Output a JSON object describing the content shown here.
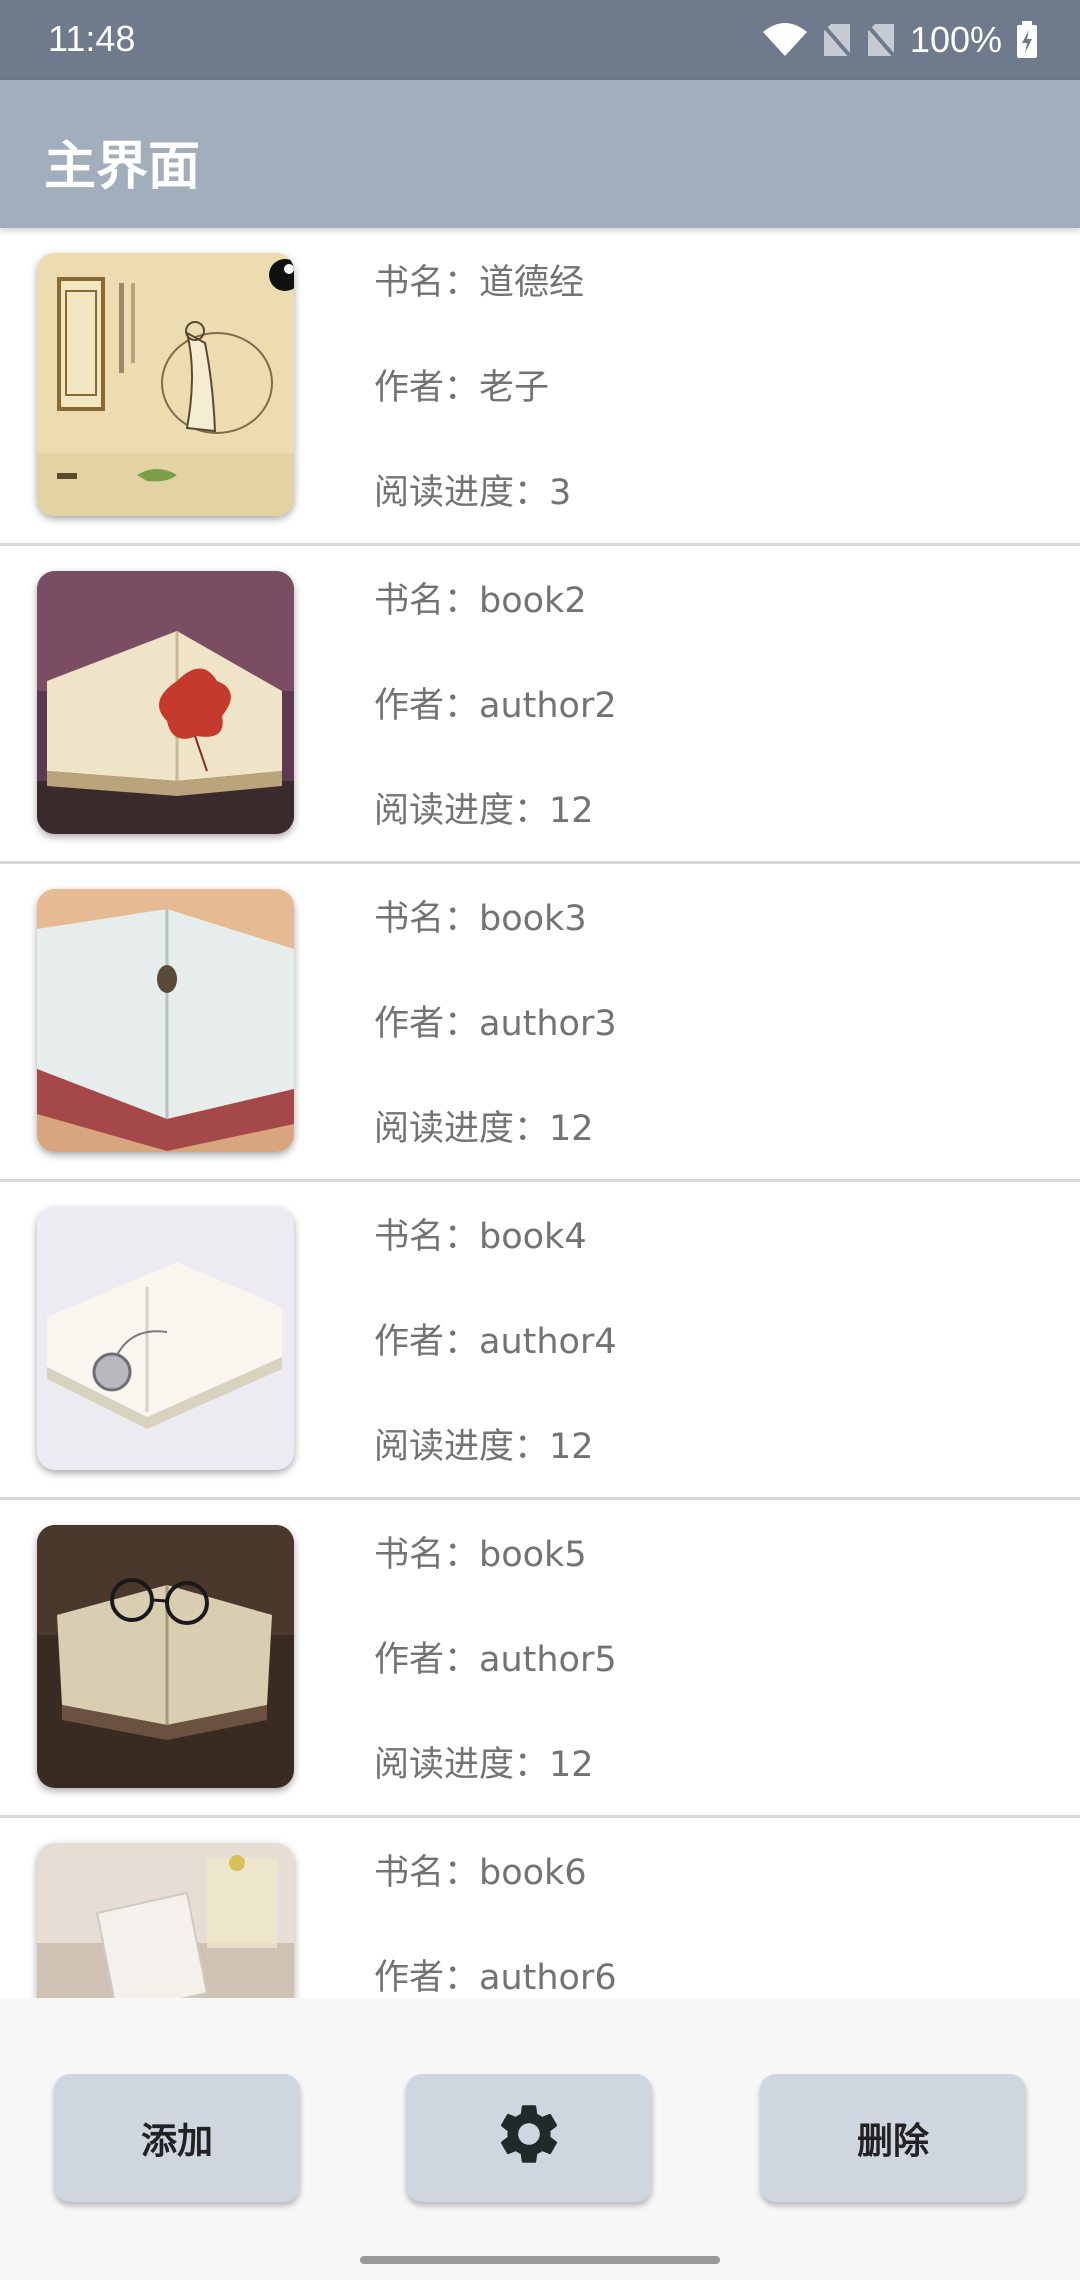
{
  "status_bar": {
    "time": "11:48",
    "battery": "100%",
    "icons": [
      "wifi-icon",
      "no-sim-icon",
      "no-sim-icon",
      "battery-charging-icon"
    ]
  },
  "app_bar": {
    "title": "主界面"
  },
  "books": [
    {
      "name_line": "书名：道德经",
      "author_line": "作者：老子",
      "progress_line": "阅读进度：3"
    },
    {
      "name_line": "书名：book2",
      "author_line": "作者：author2",
      "progress_line": "阅读进度：12"
    },
    {
      "name_line": "书名：book3",
      "author_line": "作者：author3",
      "progress_line": "阅读进度：12"
    },
    {
      "name_line": "书名：book4",
      "author_line": "作者：author4",
      "progress_line": "阅读进度：12"
    },
    {
      "name_line": "书名：book5",
      "author_line": "作者：author5",
      "progress_line": "阅读进度：12"
    },
    {
      "name_line": "书名：book6",
      "author_line": "作者：author6",
      "progress_line": ""
    }
  ],
  "bottom_bar": {
    "add_label": "添加",
    "settings_icon": "gear-icon",
    "delete_label": "删除"
  },
  "colors": {
    "status_bar": "#6f7a8c",
    "app_bar": "#a3aebd",
    "button_bg": "#cfd6e0",
    "text_gray": "#737373"
  }
}
